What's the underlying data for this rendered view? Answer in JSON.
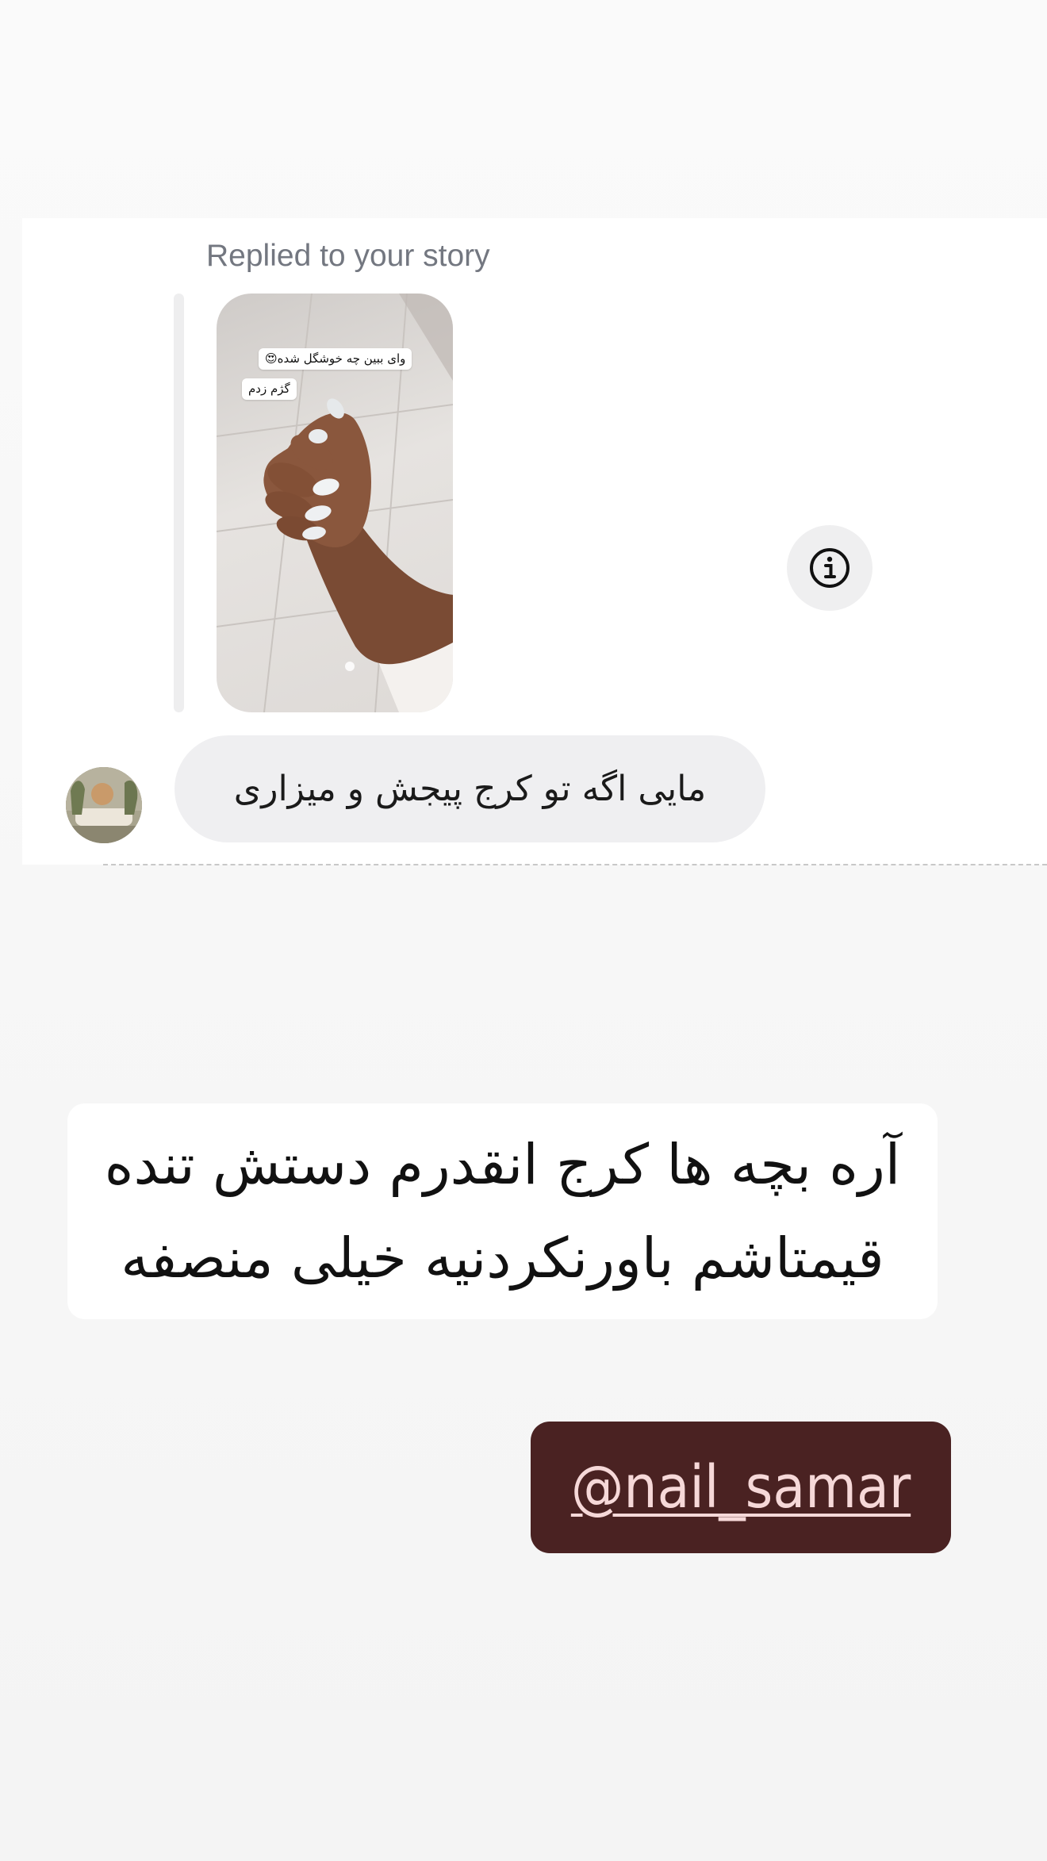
{
  "dm_card": {
    "reply_label": "Replied to your story",
    "story_stickers": [
      "وای ببین چه خوشگل شده😍",
      "گژم زدم"
    ],
    "message": "مایی اگه تو کرج پیجش و میزاری"
  },
  "caption": {
    "line1": "آره بچه ها کرج انقدرم دستش تنده",
    "line2": "قیمتاشم باورنکردنیه خیلی منصفه"
  },
  "mention": {
    "text": "@nail_samar"
  },
  "icons": {
    "info": "info-icon"
  },
  "colors": {
    "mention_bg": "#4a2222",
    "mention_text": "#f6d8d8",
    "bubble_bg": "#efeff1",
    "label_gray": "#737780"
  }
}
